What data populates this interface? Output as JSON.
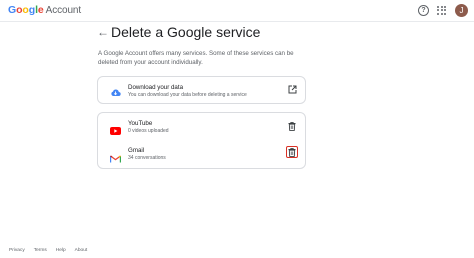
{
  "header": {
    "logo_letters": [
      "G",
      "o",
      "o",
      "g",
      "l",
      "e"
    ],
    "product": "Account",
    "avatar_initial": "J"
  },
  "page": {
    "title": "Delete a Google service",
    "intro": "A Google Account offers many services. Some of these services can be deleted from your account individually."
  },
  "download": {
    "title": "Download your data",
    "subtitle": "You can download your data before deleting a service"
  },
  "services": [
    {
      "name": "YouTube",
      "detail": "0 videos uploaded"
    },
    {
      "name": "Gmail",
      "detail": "34 conversations"
    }
  ],
  "footer": {
    "links": [
      "Privacy",
      "Terms",
      "Help",
      "About"
    ]
  },
  "colors": {
    "accent_blue": "#4285f4",
    "highlight_red": "#d93025"
  },
  "icons": [
    "help-icon",
    "apps-grid-icon",
    "back-arrow-icon",
    "cloud-download-icon",
    "open-external-icon",
    "youtube-icon",
    "gmail-icon",
    "trash-icon"
  ]
}
